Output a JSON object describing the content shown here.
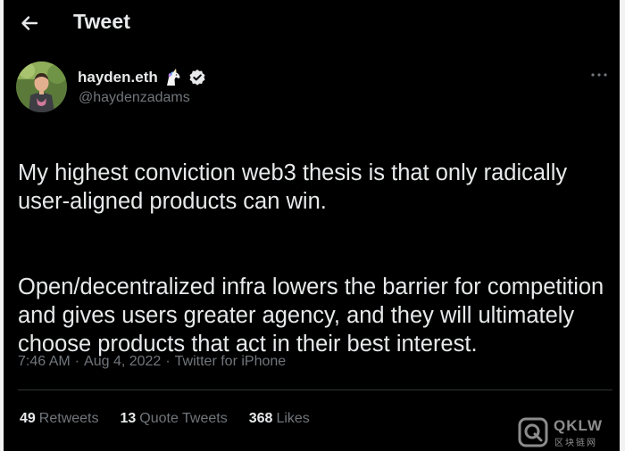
{
  "header": {
    "back_icon": "arrow-left-icon",
    "title": "Tweet"
  },
  "author": {
    "display_name": "hayden.eth",
    "emoji_icon": "unicorn-icon",
    "verified_icon": "verified-badge-icon",
    "handle": "@haydenzadams",
    "more_icon": "more-horizontal-icon"
  },
  "tweet": {
    "paragraphs": [
      "My highest conviction web3 thesis is that only radically user-aligned products can win.",
      "Open/decentralized infra lowers the barrier for competition and gives users greater agency, and they will ultimately choose products that act in their best interest."
    ],
    "time": "7:46 AM",
    "separator": "·",
    "date": "Aug 4, 2022",
    "source": "Twitter for iPhone"
  },
  "stats": {
    "retweets": {
      "count": "49",
      "label": "Retweets"
    },
    "quote_tweets": {
      "count": "13",
      "label": "Quote Tweets"
    },
    "likes": {
      "count": "368",
      "label": "Likes"
    }
  },
  "watermark": {
    "text": "QKLW",
    "subtext": "区块链网"
  },
  "colors": {
    "background": "#000000",
    "primary_text": "#e7e9ea",
    "secondary_text": "#71767b",
    "verified": "#e7e9ea"
  }
}
